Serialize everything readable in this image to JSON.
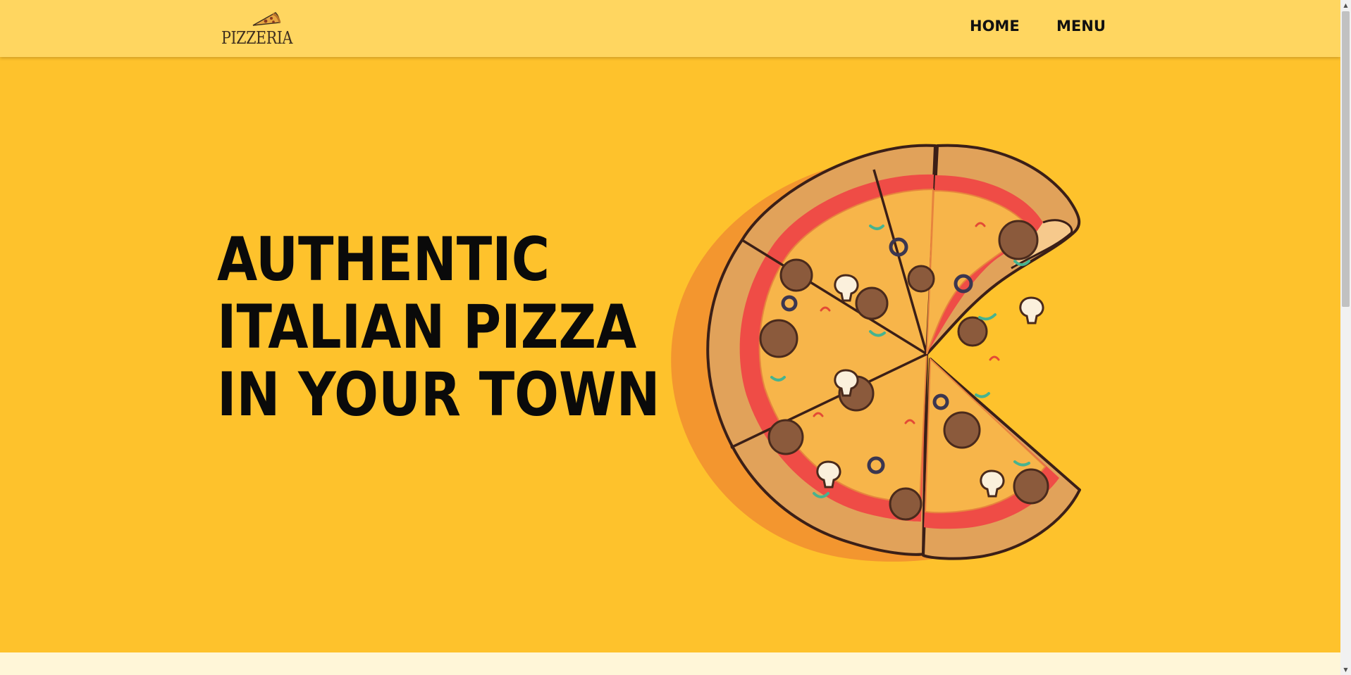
{
  "brand": {
    "name": "PIZZERIA"
  },
  "nav": {
    "items": [
      "HOME",
      "MENU"
    ]
  },
  "hero": {
    "headline_lines": [
      "AUTHENTIC",
      "ITALIAN PIZZA",
      "IN YOUR TOWN"
    ],
    "image_icon": "pizza-illustration"
  },
  "colors": {
    "navbar": "#ffd660",
    "hero_background": "#fec22c",
    "text": "#0a0a0a",
    "crust": "#e1a25a",
    "sauce": "#ef4c46",
    "cheese": "#f7b54a",
    "pepperoni": "#8b5a3c"
  },
  "scrollbar": {
    "up_icon": "scroll-up-arrow-icon",
    "down_icon": "scroll-down-arrow-icon"
  }
}
